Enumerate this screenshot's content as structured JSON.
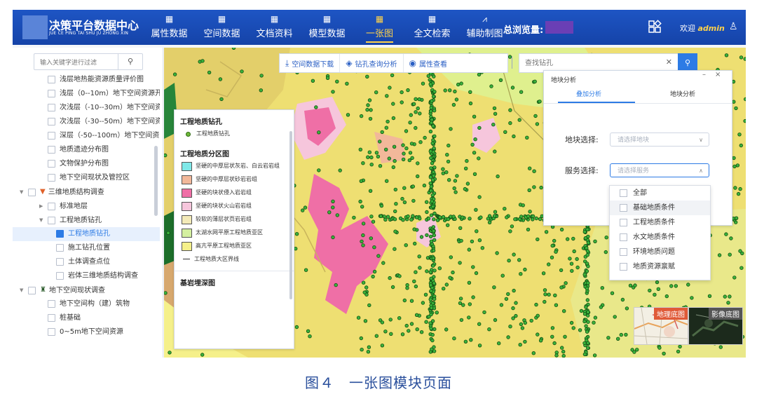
{
  "header": {
    "brand_title": "决策平台数据中心",
    "brand_subtitle": "JUE CE PING TAI SHU JU ZHONG XIN",
    "nav": [
      {
        "label": "属性数据",
        "icon": "data-icon"
      },
      {
        "label": "空间数据",
        "icon": "data-icon"
      },
      {
        "label": "文档资料",
        "icon": "data-icon"
      },
      {
        "label": "模型数据",
        "icon": "data-icon"
      },
      {
        "label": "一张图",
        "icon": "map-icon",
        "active": true
      },
      {
        "label": "全文检索",
        "icon": "data-icon"
      },
      {
        "label": "辅助制图",
        "icon": "chart-icon"
      }
    ],
    "visits_label": "总浏览量:",
    "welcome_prefix": "欢迎",
    "username": "admin"
  },
  "sidebar": {
    "search_placeholder": "输入关键字进行过滤",
    "items": [
      {
        "label": "浅层地热能资源质量评价图",
        "indent": 1
      },
      {
        "label": "浅层（0--10m）地下空间资源开:",
        "indent": 1
      },
      {
        "label": "次浅层（-10--30m）地下空间资",
        "indent": 1
      },
      {
        "label": "次浅层（-30--50m）地下空间资",
        "indent": 1
      },
      {
        "label": "深层（-50--100m）地下空间资源",
        "indent": 1
      },
      {
        "label": "地质遗迹分布图",
        "indent": 1
      },
      {
        "label": "文物保护分布图",
        "indent": 1
      },
      {
        "label": "地下空间现状及管控区",
        "indent": 1
      },
      {
        "label": "三维地质结构调查",
        "indent": 0,
        "arrow": "▼",
        "icon": "filter-icon"
      },
      {
        "label": "标准地层",
        "indent": 1,
        "arrow": "▶"
      },
      {
        "label": "工程地质钻孔",
        "indent": 1,
        "arrow": "▼"
      },
      {
        "label": "工程地质钻孔",
        "indent": 2,
        "checked": true,
        "selected": true
      },
      {
        "label": "施工钻孔位置",
        "indent": 2
      },
      {
        "label": "土体调查点位",
        "indent": 2
      },
      {
        "label": "岩体三维地质结构调查",
        "indent": 2
      },
      {
        "label": "地下空间现状调查",
        "indent": 0,
        "arrow": "▼",
        "icon": "building-icon"
      },
      {
        "label": "地下空间构（建）筑物",
        "indent": 1
      },
      {
        "label": "桩基础",
        "indent": 1
      },
      {
        "label": "0~5m地下空间资源",
        "indent": 1
      }
    ]
  },
  "toolbar": {
    "download_label": "空间数据下载",
    "drill_query_label": "钻孔查询分析",
    "attribute_label": "属性查看",
    "drill_search_placeholder": "查找钻孔"
  },
  "legend": {
    "section1_title": "工程地质钻孔",
    "borehole_label": "工程地质钻孔",
    "section2_title": "工程地质分区图",
    "zones": [
      {
        "label": "坚硬的中厚层状灰岩、白云岩岩组",
        "color": "#7fe8e8"
      },
      {
        "label": "坚硬的中厚层状砂岩岩组",
        "color": "#f2b89a"
      },
      {
        "label": "坚硬的块状侵入岩岩组",
        "color": "#ef6fa6"
      },
      {
        "label": "坚硬的块状火山岩岩组",
        "color": "#f6c6dc"
      },
      {
        "label": "较软的薄层状页岩岩组",
        "color": "#f3eab8"
      },
      {
        "label": "太湖水网平原工程地质亚区",
        "color": "#d4f0a0"
      },
      {
        "label": "高亢平原工程地质亚区",
        "color": "#f5f08a"
      }
    ],
    "boundary_label": "工程地质大区界线",
    "section3_title": "基岩埋深图"
  },
  "panel": {
    "title": "地块分析",
    "tab_overlay": "叠加分析",
    "tab_block": "地块分析",
    "block_select_label": "地块选择:",
    "block_select_placeholder": "请选择地块",
    "service_select_label": "服务选择:",
    "service_select_placeholder": "请选择服务"
  },
  "service_options": [
    "全部",
    "基础地质条件",
    "工程地质条件",
    "水文地质条件",
    "环境地质问题",
    "地质资源禀赋"
  ],
  "basemaps": {
    "geo_label": "地理底图",
    "image_label": "影像底图"
  },
  "caption": "图４　一张图模块页面"
}
